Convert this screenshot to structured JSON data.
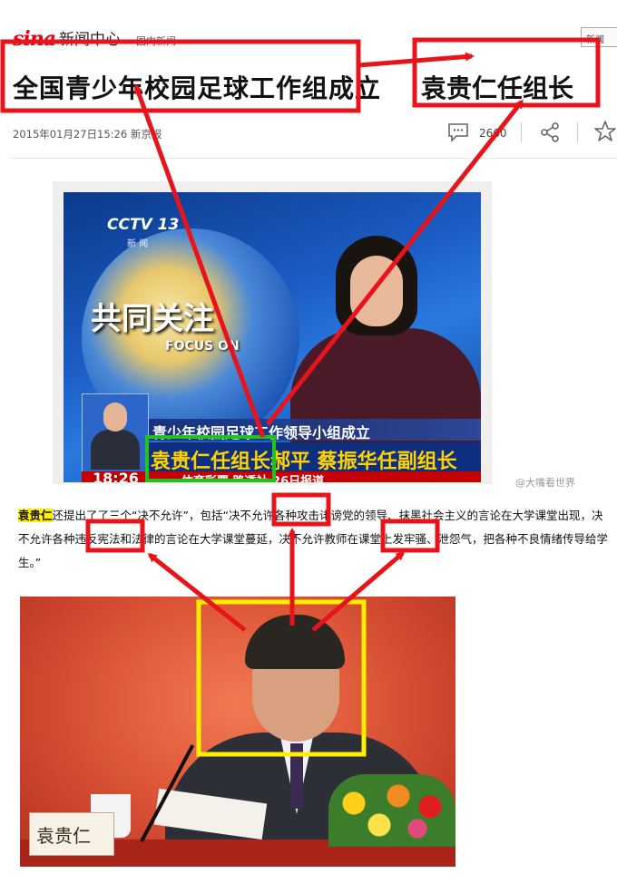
{
  "header": {
    "logo_mark": "sina",
    "logo_text": "新闻中心",
    "channel": "国内新闻",
    "search_label": "新闻"
  },
  "article": {
    "title": "全国青少年校园足球工作组成立",
    "title_highlight": "袁贵仁任组长",
    "timestamp": "2015年01月27日15:26",
    "source": "新京报",
    "comment_count": "2660"
  },
  "video": {
    "channel_logo": "CCTV 13",
    "channel_sub": "新 闻",
    "program_title": "共同关注",
    "program_sub": "FOCUS ON",
    "lower_third": "青少年校园足球工作领导小组成立",
    "caption_highlight": "袁贵仁任组长",
    "caption_rest": "郝平 蔡振华任副组长",
    "clock": "18:26",
    "ticker": "体育彩票       路透社 26日报道"
  },
  "watermark": "@大嘴看世界",
  "paragraph": {
    "name": "袁贵仁",
    "seg1": "还提出了了三个“决不允许”，包括“",
    "phrase1": "决不允许",
    "seg2": "各种攻击诽谤党的领导、抹黑社会主义的言论在大学课堂出现，",
    "phrase2": "决不允许",
    "seg3": "各种违反宪法和法律的言论在大学课堂蔓延，",
    "phrase3": "决不允许",
    "seg4": "教师在课堂上发牢骚、泄怨气，把各种不良情绪传导给学生。”"
  },
  "photo": {
    "nameplate": "袁贵仁"
  },
  "colors": {
    "annotation_red": "#e8141b",
    "annotation_green": "#22c21e",
    "annotation_yellow": "#ffee00",
    "highlight": "#fff200"
  }
}
